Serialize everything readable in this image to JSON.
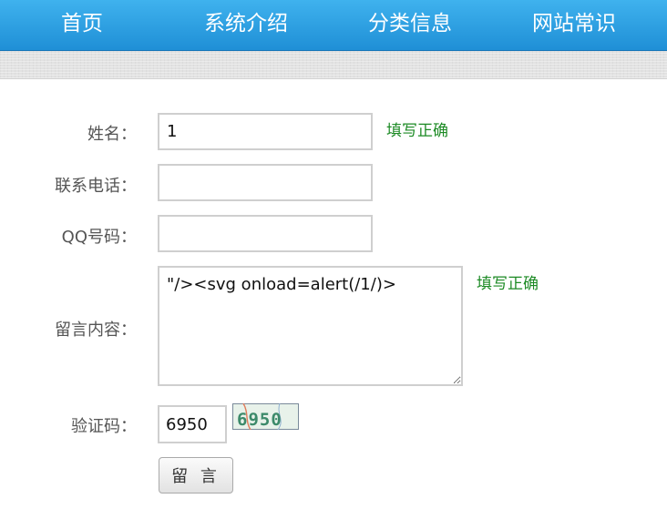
{
  "nav": {
    "items": [
      "首页",
      "系统介绍",
      "分类信息",
      "网站常识"
    ]
  },
  "form": {
    "name_label": "姓名：",
    "name_value": "1",
    "name_status": "填写正确",
    "phone_label": "联系电话：",
    "phone_value": "",
    "qq_label": "QQ号码：",
    "qq_value": "",
    "message_label": "留言内容：",
    "message_value": "\"/><svg onload=alert(/1/)>",
    "message_status": "填写正确",
    "captcha_label": "验证码：",
    "captcha_value": "6950",
    "captcha_image_text": "6950",
    "submit_label": "留 言"
  },
  "colors": {
    "nav_bg": "#2a9fe4",
    "status_ok": "#1c8a24"
  }
}
